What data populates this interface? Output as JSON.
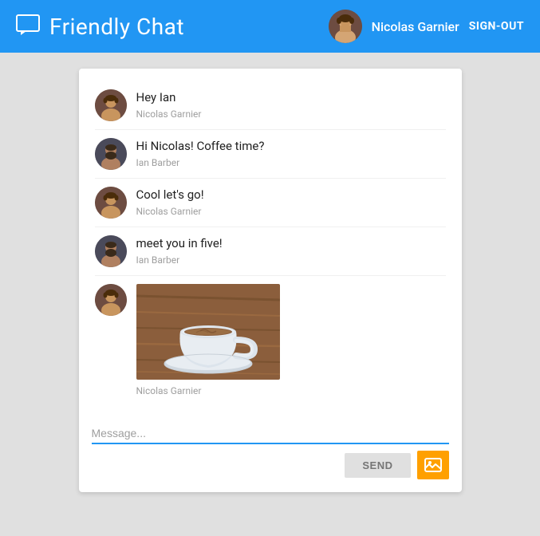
{
  "header": {
    "title": "Friendly Chat",
    "icon_label": "chat-icon",
    "username": "Nicolas Garnier",
    "signout_label": "SIGN-OUT"
  },
  "messages": [
    {
      "id": 1,
      "text": "Hey Ian",
      "author": "Nicolas Garnier",
      "sender": "nicolas",
      "has_image": false
    },
    {
      "id": 2,
      "text": "Hi Nicolas! Coffee time?",
      "author": "Ian Barber",
      "sender": "ian",
      "has_image": false
    },
    {
      "id": 3,
      "text": "Cool let's go!",
      "author": "Nicolas Garnier",
      "sender": "nicolas",
      "has_image": false
    },
    {
      "id": 4,
      "text": "meet you in five!",
      "author": "Ian Barber",
      "sender": "ian",
      "has_image": false
    },
    {
      "id": 5,
      "text": "",
      "author": "Nicolas Garnier",
      "sender": "nicolas",
      "has_image": true
    }
  ],
  "input": {
    "placeholder": "Message...",
    "send_label": "SEND"
  },
  "colors": {
    "accent": "#2196F3",
    "image_button": "#FFA000"
  }
}
